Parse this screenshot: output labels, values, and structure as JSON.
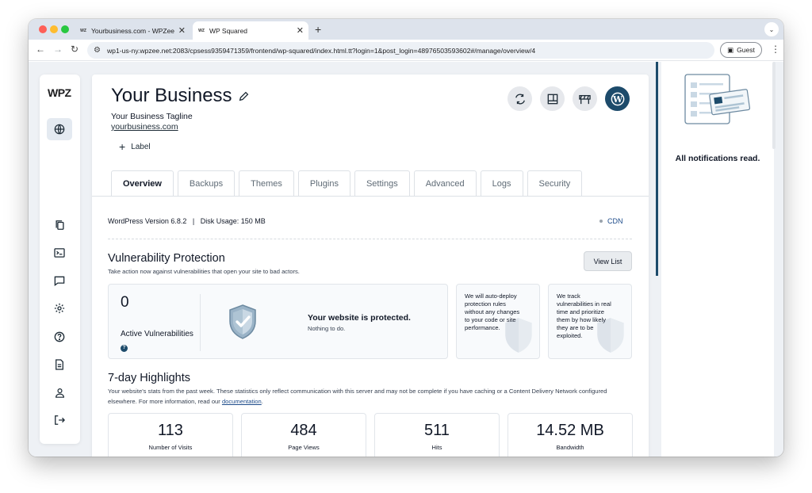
{
  "browser": {
    "tabs": [
      {
        "favicon": "WZ",
        "title": "Yourbusiness.com - WPZee",
        "active": false
      },
      {
        "favicon": "WZ",
        "title": "WP Squared",
        "active": true
      }
    ],
    "url": "wp1-us-ny.wpzee.net:2083/cpsess9359471359/frontend/wp-squared/index.html.tt?login=1&post_login=48976503593602#/manage/overview/4",
    "profile_label": "Guest"
  },
  "sidebar": {
    "logo": "WPZ",
    "icons": [
      "globe-icon",
      "copy-icon",
      "terminal-icon",
      "chat-icon",
      "gear-icon",
      "help-icon",
      "document-icon",
      "user-icon",
      "logout-icon"
    ]
  },
  "site": {
    "title": "Your Business",
    "tagline": "Your Business Tagline",
    "url": "yourbusiness.com",
    "add_label": "Label"
  },
  "tabs": [
    "Overview",
    "Backups",
    "Themes",
    "Plugins",
    "Settings",
    "Advanced",
    "Logs",
    "Security"
  ],
  "active_tab": "Overview",
  "info": {
    "line": "WordPress Version 6.8.2   |   Disk Usage: 150 MB",
    "cdn": "CDN"
  },
  "vulnerability": {
    "title": "Vulnerability Protection",
    "subtitle": "Take action now against vulnerabilities that open your site to bad actors.",
    "view_list": "View List",
    "count": "0",
    "count_label": "Active Vulnerabilities",
    "status_title": "Your website is protected.",
    "status_sub": "Nothing to do.",
    "info_cards": [
      "We will auto-deploy protection rules without any changes to your code or site performance.",
      "We track vulnerabilities in real time and prioritize them by how likely they are to be exploited."
    ]
  },
  "highlights": {
    "title": "7-day Highlights",
    "subtitle": "Your website's stats from the past week. These statistics only reflect communication with this server and may not be complete if you have caching or a Content Delivery Network configured elsewhere. For more information, read our",
    "link": "documentation",
    "stats": [
      {
        "value": "113",
        "label": "Number of Visits"
      },
      {
        "value": "484",
        "label": "Page Views"
      },
      {
        "value": "511",
        "label": "Hits"
      },
      {
        "value": "14.52 MB",
        "label": "Bandwidth"
      }
    ]
  },
  "notifications": {
    "status": "All notifications read."
  },
  "colors": {
    "accent": "#1d4b6b",
    "tab_bar": "#dde3ec",
    "page_bg": "#eef1f5"
  }
}
